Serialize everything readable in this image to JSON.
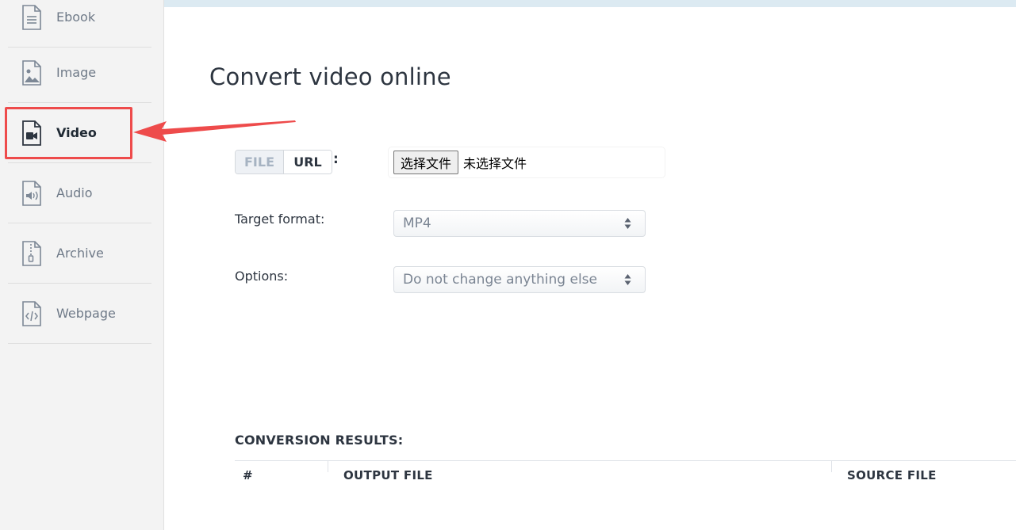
{
  "sidebar": {
    "items": [
      {
        "label": "Ebook",
        "icon": "ebook-icon"
      },
      {
        "label": "Image",
        "icon": "image-icon"
      },
      {
        "label": "Video",
        "icon": "video-icon",
        "active": true
      },
      {
        "label": "Audio",
        "icon": "audio-icon"
      },
      {
        "label": "Archive",
        "icon": "archive-icon"
      },
      {
        "label": "Webpage",
        "icon": "webpage-icon"
      }
    ]
  },
  "annotation": {
    "color": "#ee4b4b"
  },
  "main": {
    "title": "Convert video online",
    "source_toggle": {
      "file_label": "FILE",
      "url_label": "URL",
      "colon": ":"
    },
    "file_picker": {
      "button_label": "选择文件",
      "status": "未选择文件"
    },
    "target_format": {
      "label": "Target format:",
      "value": "MP4"
    },
    "options": {
      "label": "Options:",
      "value": "Do not change anything else"
    },
    "results": {
      "label": "CONVERSION RESULTS:",
      "columns": [
        "#",
        "OUTPUT FILE",
        "SOURCE FILE"
      ]
    }
  },
  "colors": {
    "sidebar_bg": "#f3f3f3",
    "topbar": "#dceaf2",
    "text": "#2d3540",
    "muted_text": "#6f7a88"
  }
}
